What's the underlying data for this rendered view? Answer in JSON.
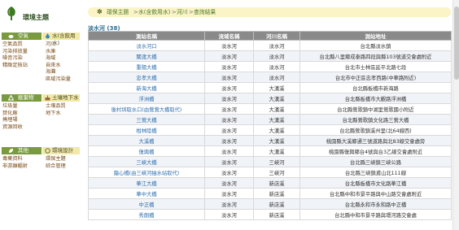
{
  "sidebar": {
    "title": "環境主題",
    "categories": [
      {
        "left_label": "空氣",
        "right_label": "水(含飲用水)",
        "left_links": [
          "空氣品質",
          "污染排放量",
          "噪音污染",
          "精緻定檢站"
        ],
        "right_links": [
          "河川",
          "水庫",
          "海域",
          "自來水",
          "海灘",
          "區域污染量"
        ]
      },
      {
        "left_label": "廢棄物",
        "right_label": "土壤地下水",
        "left_links": [
          "垃圾量",
          "焚化廠",
          "掩埋場",
          "資源回收"
        ],
        "right_links": [
          "土壤品質",
          "地下水"
        ]
      },
      {
        "left_label": "其他",
        "right_label": "環境設計",
        "left_links": [
          "毒藥資料",
          "非游離輻射"
        ],
        "right_links": [
          "環保主題",
          "綜合管理"
        ]
      }
    ]
  },
  "breadcrumb": {
    "star": "✽",
    "items": [
      "環保主題",
      "水(含飲用水)",
      "河川",
      "查詢結果"
    ],
    "separator": ">"
  },
  "result": {
    "title": "淡水河 (38)"
  },
  "table": {
    "columns": [
      "測站名稱",
      "流域名稱",
      "河川名稱",
      "測站地址"
    ],
    "rows": [
      [
        "淡水河口",
        "淡水河",
        "淡水河",
        "台北縣淡水鎮"
      ],
      [
        "關渡大橋",
        "淡水河",
        "淡水河",
        "台北縣八里鄉成泰路四段與縣103號道交會處附近"
      ],
      [
        "重陽大橋",
        "淡水河",
        "淡水河",
        "台北市士林區延平北路七段"
      ],
      [
        "忠孝大橋",
        "淡水河",
        "淡水河",
        "台北市中正區忠孝西路(中華路附近)"
      ],
      [
        "新海大橋",
        "淡水河",
        "大漢溪",
        "台北縣板橋市新海路"
      ],
      [
        "浮洲橋",
        "淡水河",
        "大漢溪",
        "台北縣板橋市大觀路浮洲橋"
      ],
      [
        "後村圳取水口(由鶯鶯大橋取代)",
        "淡水河",
        "大漢溪",
        "台北縣鶯歌鎮中湖里鶯歌國小附近"
      ],
      [
        "三鶯大橋",
        "淡水河",
        "大漢溪",
        "台北縣鶯歌鎮文化路三鶯大橋"
      ],
      [
        "柑林陸橋",
        "淡水河",
        "大漢溪",
        "台北縣鶯歌鎮溪州里(北64線西)"
      ],
      [
        "大溪橋",
        "淡水河",
        "大漢溪",
        "桃園縣大溪鄉通三號道路與北83線交會處旁"
      ],
      [
        "復興橋",
        "淡水河",
        "大漢溪",
        "桃園縣復興鄉台4號與台3乙線交會處附近"
      ],
      [
        "三峽大橋",
        "淡水河",
        "三峽河",
        "台北縣三峽鎮三峽公路"
      ],
      [
        "龍心橋(由三峽河抽水站取代)",
        "淡水河",
        "三峽河",
        "台北縣三峽鎮鳶山北111線"
      ],
      [
        "華江大橋",
        "淡水河",
        "新店溪",
        "台北縣板橋市文化路華江橋"
      ],
      [
        "華中大橋",
        "淡水河",
        "新店溪",
        "台北縣中和市景平路與中山路交會處附近"
      ],
      [
        "中正橋",
        "淡水河",
        "新店溪",
        "台北縣永和市永和路中正橋"
      ],
      [
        "秀朗橋",
        "淡水河",
        "新店溪",
        "台北縣中和市景平路與環河路交會處"
      ]
    ]
  },
  "colors": {
    "category_bar_left": "#7a9a3f",
    "category_bar_right": "#f1e9a8",
    "table_header": "#8a8a8a",
    "link_orange": "#7a4a14",
    "site_link": "#2f6fae",
    "breadcrumb_bg": "#fbf4c6"
  }
}
